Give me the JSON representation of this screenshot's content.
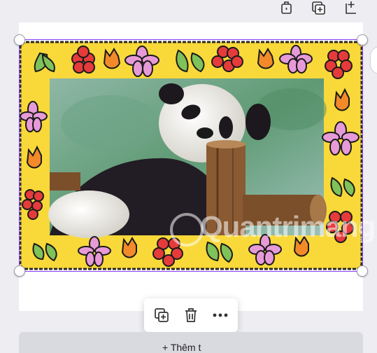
{
  "top_toolbar": {
    "icons": [
      "lock-icon",
      "add-page-icon",
      "duplicate-page-icon"
    ]
  },
  "design_element": {
    "image": "panda-photo",
    "frame": "yellow-flower-border",
    "selected": true,
    "colors": {
      "frame": "#f9d83a",
      "selection": "#8b3dff"
    }
  },
  "context_menu": {
    "icons": [
      "copy-icon",
      "trash-icon",
      "more-icon"
    ]
  },
  "bottom_panel": {
    "label": "+ Thêm t"
  },
  "watermark": {
    "text": "Quantrimang"
  }
}
